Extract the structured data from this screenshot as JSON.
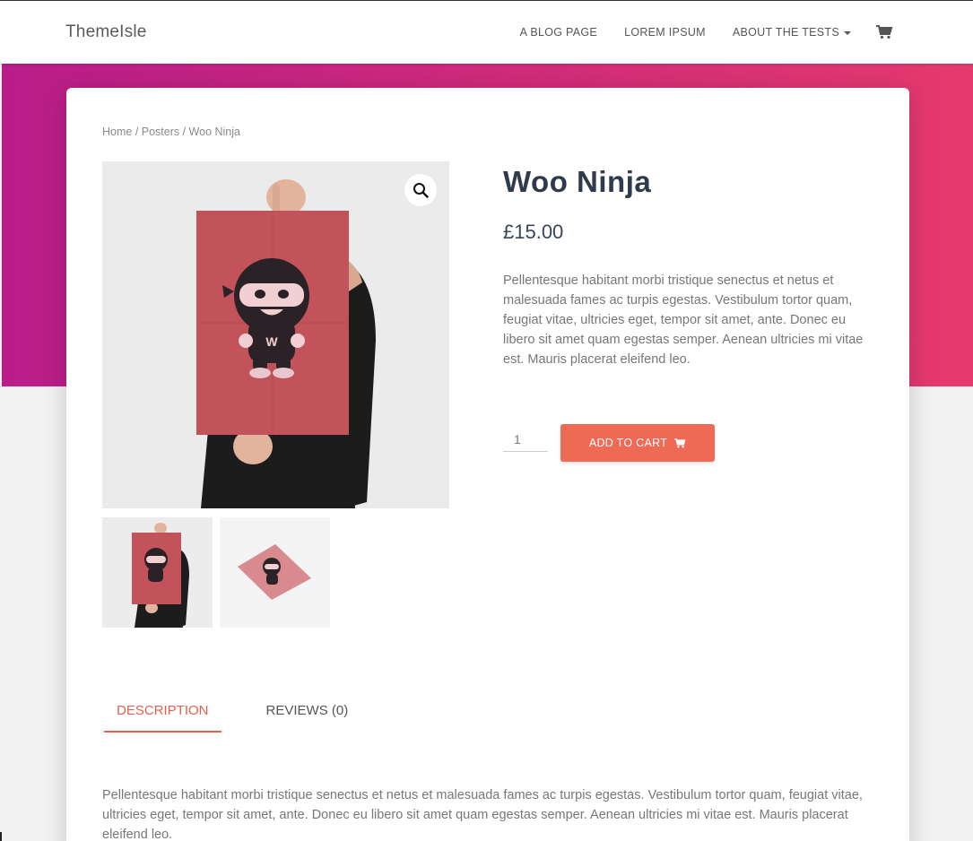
{
  "header": {
    "logo": "ThemeIsle",
    "nav": [
      {
        "label": "A BLOG PAGE"
      },
      {
        "label": "LOREM IPSUM"
      },
      {
        "label": "ABOUT THE TESTS",
        "dropdown": true
      }
    ],
    "cart_icon": "shopping-cart-icon"
  },
  "breadcrumb": {
    "text": "Home / Posters / Woo Ninja"
  },
  "product": {
    "title": "Woo Ninja",
    "price": "£15.00",
    "short_description": "Pellentesque habitant morbi tristique senectus et netus et malesuada fames ac turpis egestas. Vestibulum tortor quam, feugiat vitae, ultricies eget, tempor sit amet, ante. Donec eu libero sit amet quam egestas semper. Aenean ultricies mi vitae est. Mauris placerat eleifend leo.",
    "quantity": "1",
    "add_to_cart_label": "ADD TO CART",
    "poster_letter": "W"
  },
  "tabs": [
    {
      "label": "DESCRIPTION",
      "active": true
    },
    {
      "label": "REVIEWS (0)",
      "active": false
    }
  ],
  "description": "Pellentesque habitant morbi tristique senectus et netus et malesuada fames ac turpis egestas. Vestibulum tortor quam, feugiat vitae, ultricies eget, tempor sit amet, ante. Donec eu libero sit amet quam egestas semper. Aenean ultricies mi vitae est. Mauris placerat eleifend leo.",
  "colors": {
    "hero_start": "#b91d8a",
    "hero_end": "#e63a6e",
    "accent": "#ef6a55",
    "title": "#2f3a4a"
  }
}
